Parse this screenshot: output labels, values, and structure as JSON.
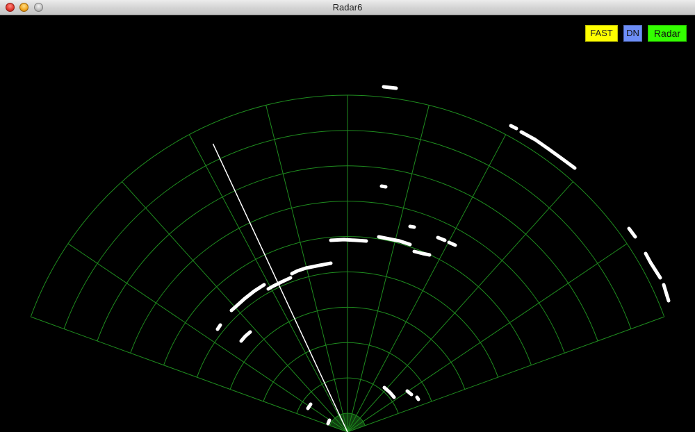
{
  "window": {
    "title": "Radar6"
  },
  "buttons": {
    "fast": {
      "label": "FAST",
      "color": "#ffff00"
    },
    "dn": {
      "label": "DN",
      "color": "#6d8ef7"
    },
    "radar": {
      "label": "Radar",
      "color": "#33ff00"
    }
  },
  "radar": {
    "grid_color": "#1f8c1f",
    "hub_color": "#0f3f0f",
    "echo_color": "#ffffff",
    "sweep_color": "#ffffff",
    "rings": 9,
    "spokes": 10,
    "sector_start_deg": -70,
    "sector_end_deg": 70,
    "sweep_angle_deg": -25
  }
}
